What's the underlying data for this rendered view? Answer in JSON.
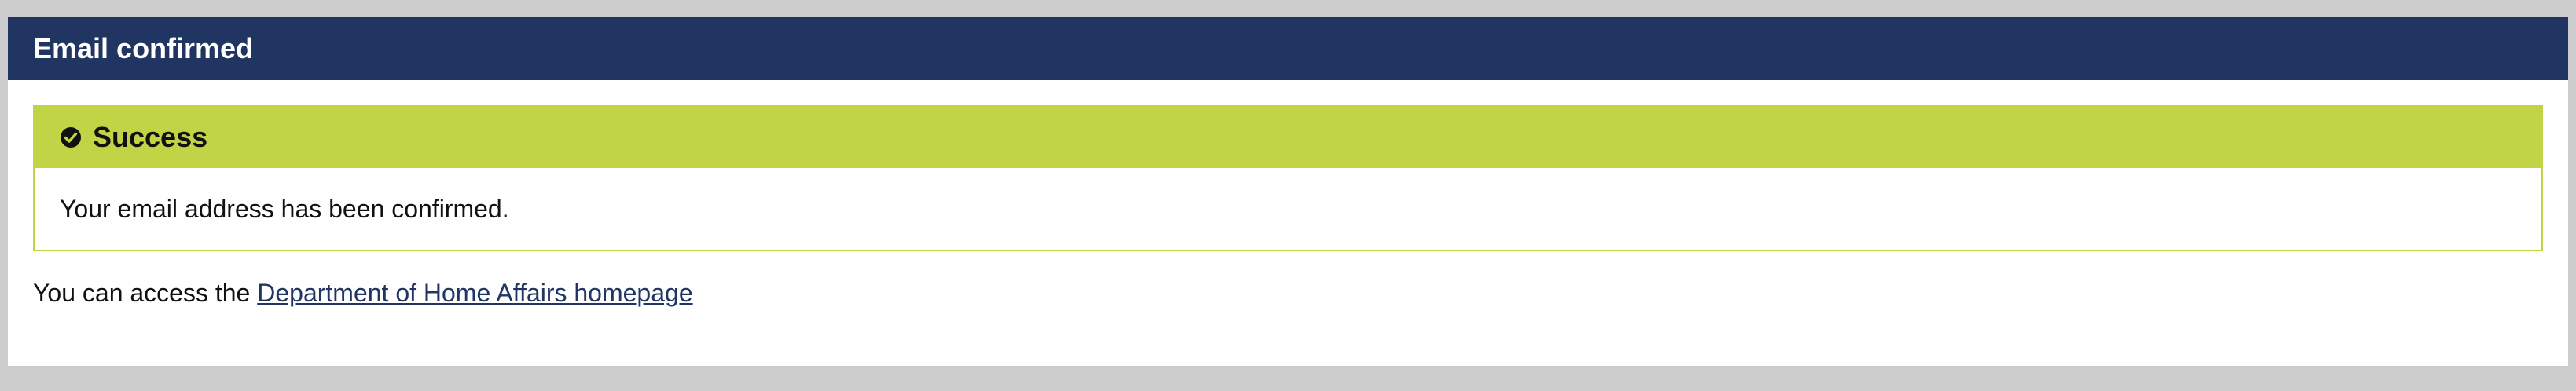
{
  "header": {
    "title": "Email confirmed"
  },
  "alert": {
    "icon": "check-circle-icon",
    "title": "Success",
    "message": "Your email address has been confirmed."
  },
  "access": {
    "prefix": "You can access the ",
    "link_text": "Department of Home Affairs homepage"
  },
  "colors": {
    "header_bg": "#203562",
    "success": "#c0d446",
    "link": "#203562",
    "page_bg": "#cccccc"
  }
}
